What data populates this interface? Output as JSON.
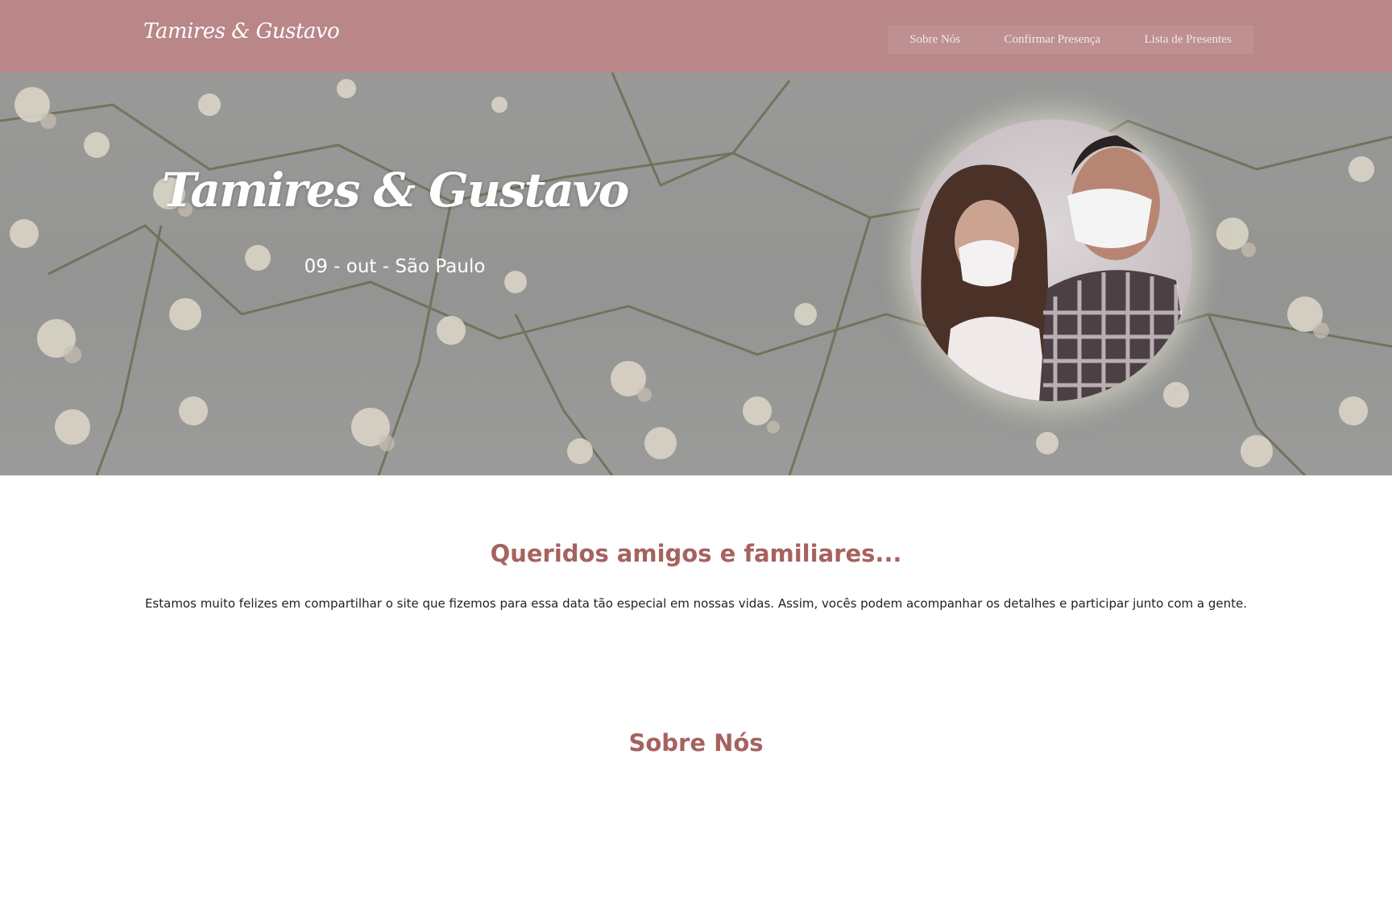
{
  "nav": {
    "brand": "Tamires & Gustavo",
    "links": [
      "Sobre Nós",
      "Confirmar Presença",
      "Lista de Presentes"
    ]
  },
  "hero": {
    "title": "Tamires & Gustavo",
    "date_location": "09 - out - São Paulo"
  },
  "intro": {
    "title": "Queridos amigos e familiares...",
    "text": "Estamos muito felizes em compartilhar o site que fizemos para essa data tão especial em nossas vidas. Assim, vocês podem acompanhar os detalhes e participar junto com a gente."
  },
  "about": {
    "title": "Sobre Nós"
  },
  "colors": {
    "navbar": "#b98788",
    "accent": "#a6625f",
    "text": "#222222"
  }
}
